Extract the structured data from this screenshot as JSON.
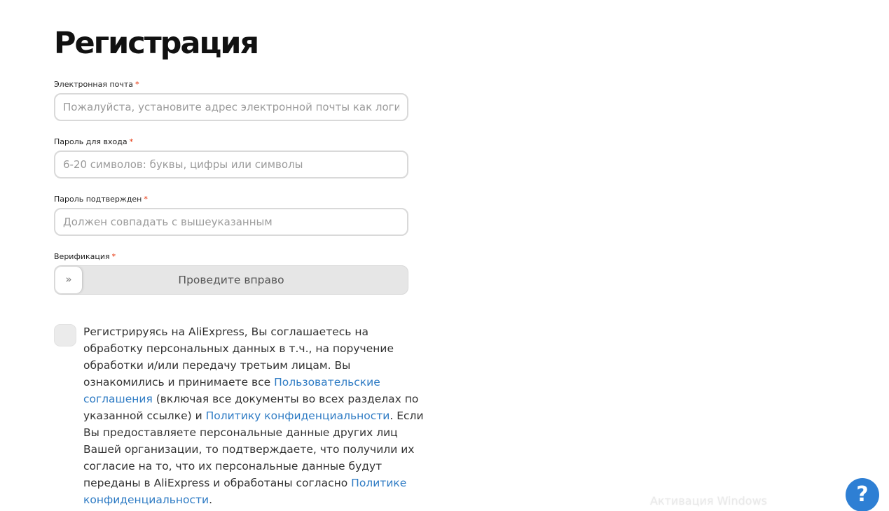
{
  "title": "Регистрация",
  "fields": [
    {
      "label": "Электронная почта",
      "required_mark": "*",
      "placeholder": "Пожалуйста, установите адрес электронной почты как логин",
      "value": ""
    },
    {
      "label": "Пароль для входа",
      "required_mark": "*",
      "placeholder": "6-20 символов: буквы, цифры или символы",
      "value": ""
    },
    {
      "label": "Пароль подтвержден",
      "required_mark": "*",
      "placeholder": "Должен совпадать с вышеуказанным",
      "value": ""
    }
  ],
  "verification": {
    "label": "Верификация",
    "required_mark": "*",
    "slider_text": "Проведите вправо",
    "handle_glyph": "»"
  },
  "consent": {
    "checked": false,
    "line1": "Регистрируясь на AliExpress, Вы соглашаетесь на",
    "line2": "обработку персональных данных в т.ч., на поручение",
    "line3": "обработки и/или передачу третьим лицам. Вы",
    "line4_text": "ознакомились и принимаете все ",
    "link_terms_part1": "Пользовательские",
    "link_terms_part2": "соглашения",
    "line5_text": " (включая все документы во всех разделах по",
    "line6_text": "указанной ссылке) и ",
    "link_privacy": "Политику конфиденциальности",
    "line6_tail": ". Если",
    "line7": "Вы предоставляете персональные данные других лиц",
    "line8": "Вашей организации, то подтверждаете, что получили их",
    "line9": "согласие на то, что их персональные данные будут",
    "line10_text": "переданы в AliExpress и обработаны согласно ",
    "link_privacy2_part1": "Политике",
    "link_privacy2_part2": "конфиденциальности",
    "line11_tail": "."
  },
  "watermark": "Активация Windows",
  "help_button": {
    "glyph": "?",
    "icon": "question-icon"
  },
  "colors": {
    "link": "#2e7bc4",
    "required": "#e62e04",
    "help_button": "#2e7fd4",
    "slider_track": "#e6e6e6"
  }
}
